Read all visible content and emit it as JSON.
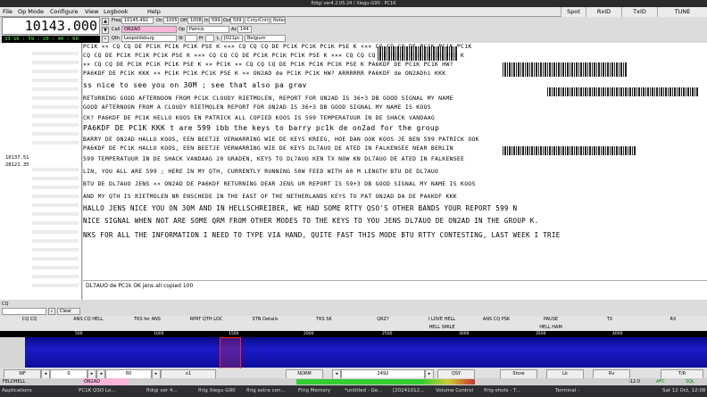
{
  "window": {
    "title": "fldigi ver4.2.05.24 / Xiegu-G90 : PC1K"
  },
  "menu": [
    "File",
    "Op Mode",
    "Configure",
    "View",
    "Logbook",
    "Help"
  ],
  "top_buttons": [
    "Spot",
    "RxID",
    "TxID",
    "TUNE"
  ],
  "vfo": {
    "frequency": "10143.000",
    "smeter_text": "S3 S6 : 59 : 20 : 40 : 60"
  },
  "log": {
    "freq_label": "Freq",
    "freq_value": "10145.492",
    "on_label": "On",
    "on_value": "1005",
    "off_label": "Off",
    "off_value": "1008",
    "in_label": "In",
    "in_value": "599",
    "out_label": "Out",
    "out_value": "599",
    "cnty_label": "Cnty/Cntry",
    "notes_label": "Notes",
    "call_label": "Call",
    "call_value": "ON2AD",
    "op_label": "Op",
    "op_value": "Patrick",
    "az_label": "Az",
    "az_value": "144",
    "qth_label": "Qth",
    "qth_value": "Leopoldsburg",
    "st_label": "St",
    "pr_label": "Pr",
    "l_label": "L",
    "loc_value": "JO21pc",
    "country_value": "Belgium"
  },
  "left_panel": {
    "freqs": [
      "10137.51",
      "28121.35"
    ],
    "cq_label": "CQ",
    "clear_label": "Clear"
  },
  "rx_lines": [
    "PC1K ×× CQ CQ DE PC1K PC1K PC1K PSE K ××× CQ CQ CQ DE PC1K PC1K PC1K PSE K ××× CQ CQ CQ DE PC1K PC1K PC1K",
    "CQ CQ DE PC1K PC1K PC1K PSE K ××× CQ CQ CQ DE PC1K PC1K PC1K PSE K ××× CQ CQ CQ DE PC1K PC1K PC1K PSE K",
    "×× CQ CQ DE PC1K PC1K PC1K PSE K ×× PC1K ×× CQ CQ CQ DE PC1K PC1K PC1K PSE K   PA6KDF DE PC1K PC1K HW?",
    "PA6KDF DE PC1K KKK ×× PC1K PC1K PC1K PSE K ×× ON2AD de PC1K PC1K HW?  ARRRRRR  PA6KDF de ON2ADhi KKK",
    "ss nice to see you on 30M ; see that also pa  grav",
    "RETURNING  GOOD AFTERNOON FROM PC1K CLOUDY RIETMOLEN, REPORT FOR ON2AD IS 36+3 DB   GOOD  SIGNAL  MY NAME",
    "GOOD AFTERNOON FROM A CLOUDY RIETMOLEN REPORT FOR ON2AD IS 36+3 DB    GOOD  SIGNAL  MY NAME IS KOOS",
    "CK?   PA6KDF DE PC1K HELLO KOOS EN PATRICK  ALL COPIED KOOS IS 599 TEMPERATUUR IN DE SHACK VANDAAG",
    "PA6KDF DE PC1K KKK  t are 599 ibb the keys to barry pc1k de on2ad for the group",
    "BARRY DE ON2AD HALLO KOOS, EEN BEETJE VERWARRING WIE DE KEYS KREEG, HOE DAN OOK KOOS JE BEN 599 PATRICK OOK",
    "  PA6KDF DE PC1K HALLO KOOS, EEN BEETJE VERWARRING WIE DE KEYS  DL7AUO DE ATED IN FALKENSEE NEAR BERLIN",
    "599 TEMPERATUUR IN DE SHACK VANDAAG 20 GRADEN, KEYS TO DL7AUO KEN TX NOW KN  DL7AUO DE ATED IN FALKENSEE",
    "LIN, YOU ALL ARE 599 ; HERE IN MY QTH, CURRENTLY RUNNING 50W FEED WITH 60 M LENGTH  BTU DE DL7AUO",
    "BTU DE DL7AUO  JENS ×× ON2AD DE PA6KDF RETURNING  DEAR JENS  UR REPORT IS 59+3 DB  GOOD SIGNAL  MY NAME IS KOOS",
    "AND MY QTH IS RIETMOLEN  NR ENSCHEDE IN THE EAST OF THE NETHERLANDS  KEYS TO PAT  ON2AD DA DE PA6KDF KKK",
    "HALLO JENS NICE YOU ON 30M AND IN HELLSCHREIBER, WE HAD SOME RTTY QSO'S  OTHER BANDS YOUR REPORT 599 N",
    "NICE SIGNAL WHEN NOT ARE SOME QRM FROM OTHER MODES TO THE KEYS TO YOU JENS DL7AUO DE ON2AD IN THE GROUP K.",
    "NKS FOR ALL THE INFORMATION I NEED TO TYPE VIA HAND, QUITE FAST THIS MODE  BTU RTTY CONTESTING, LAST WEEK I TRIE"
  ],
  "tx_text": "DL7AUO de PC1k OK jens all copied 100",
  "macros_row1": [
    "CQ CQ",
    "ANS CQ HELL",
    "TKS fer ANS",
    "RPRT QTH LOC",
    "STN Details",
    "TKS SK",
    "QRZ?",
    "I LOVE HELL",
    "ANS CQ PSK",
    "PAUSE",
    "TX",
    "RX"
  ],
  "macros_row2": [
    "",
    "",
    "",
    "",
    "",
    "",
    "",
    "HELL SMILE",
    "",
    "HELL HAM",
    "",
    ""
  ],
  "scale_labels": [
    "500",
    "1000",
    "1500",
    "2000",
    "2500",
    "3000",
    "3500",
    "4000"
  ],
  "controls": {
    "wf_label": "WF",
    "wf_value": "0",
    "wf_value2": "60",
    "x1_label": "x1",
    "norm_label": "NORM",
    "offset_value": "2492",
    "qsy_label": "QSY",
    "store_label": "Store",
    "lk_label": "Lk",
    "rv_label": "Rv",
    "tr_label": "T/R"
  },
  "status": {
    "mode": "FELDHELL",
    "call": "ON2AD",
    "sql_label": "SQL",
    "afc_label": "AFC",
    "db_value": "-12.0"
  },
  "taskbar": {
    "apps_label": "Applications",
    "tasks": [
      "PC1K QSO Lo...",
      "fldigi ver 4...",
      "flrig Xiegu-G90",
      "flrig extra con...",
      "Flrig Memory",
      "*untitled - Ge...",
      "[20241012...",
      "Volume Control",
      "flrig-shots - T...",
      "Terminal -"
    ],
    "clock": "Sat 12 Oct, 12:08"
  },
  "colors": {
    "call_field": "#f9b6d9",
    "waterfall": "#1c1cc8",
    "smeter": "#55ff55",
    "signal_marker": "#ff2020"
  }
}
